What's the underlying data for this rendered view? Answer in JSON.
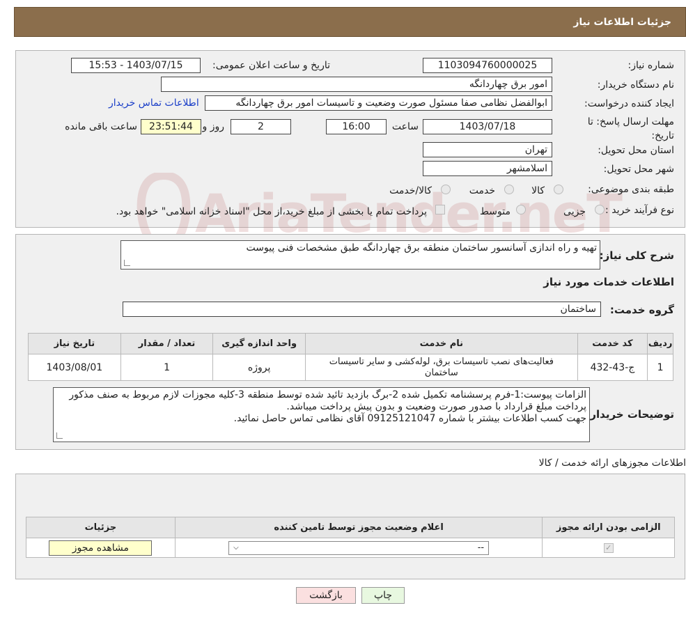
{
  "header": {
    "title": "جزئیات اطلاعات نیاز"
  },
  "watermark": {
    "text": "AriaTender.neT"
  },
  "info": {
    "need_number_label": "شماره نیاز:",
    "need_number": "1103094760000025",
    "announce_label": "تاریخ و ساعت اعلان عمومی:",
    "announce_value": "1403/07/15 - 15:53",
    "buyer_label": "نام دستگاه خریدار:",
    "buyer_value": "امور برق چهاردانگه",
    "creator_label": "ایجاد کننده درخواست:",
    "creator_value": "ابوالفضل نظامی صفا مسئول صورت وضعیت و تاسیسات امور برق چهاردانگه",
    "contact_link": "اطلاعات تماس خریدار",
    "deadline_label_1": "مهلت ارسال پاسخ: تا",
    "deadline_label_2": "تاریخ:",
    "deadline_date": "1403/07/18",
    "time_label": "ساعت",
    "deadline_time": "16:00",
    "days_value": "2",
    "days_label": "روز و",
    "remaining_value": "23:51:44",
    "remaining_label": "ساعت باقی مانده",
    "province_label": "استان محل تحویل:",
    "province_value": "تهران",
    "city_label": "شهر محل تحویل:",
    "city_value": "اسلامشهر",
    "category_label": "طبقه بندی موضوعی:",
    "category_options": [
      "کالا",
      "خدمت",
      "کالا/خدمت"
    ],
    "purchase_label": "نوع فرآیند خرید :",
    "purchase_options": [
      "جزیی",
      "متوسط"
    ],
    "purchase_note": "پرداخت تمام یا بخشی از مبلغ خرید،از محل \"اسناد خزانه اسلامی\" خواهد بود."
  },
  "description": {
    "summary_label": "شرح کلی نیاز:",
    "summary_value": "تهیه و راه اندازی آسانسور ساختمان منطقه برق چهاردانگه طبق مشخصات فنی پیوست",
    "services_title": "اطلاعات خدمات مورد نیاز",
    "service_group_label": "گروه خدمت:",
    "service_group_value": "ساختمان",
    "table_headers": [
      "ردیف",
      "کد خدمت",
      "نام خدمت",
      "واحد اندازه گیری",
      "تعداد / مقدار",
      "تاریخ نیاز"
    ],
    "rows": [
      {
        "row": "1",
        "code": "ج-43-432",
        "name": "فعالیت‌های نصب تاسیسات برق، لوله‌کشی و سایر تاسیسات ساختمان",
        "unit": "پروژه",
        "qty": "1",
        "date": "1403/08/01"
      }
    ],
    "buyer_notes_label": "توضیحات خریدار:",
    "buyer_notes": [
      "الزامات پیوست:1-فرم پرسشنامه تکمیل شده 2-برگ بازدید تائید شده توسط منطقه 3-کلیه مجوزات لازم مربوط به صنف مذکور",
      "پرداخت مبلغ قرارداد با صدور صورت وضعیت و بدون پیش پرداخت میباشد.",
      "جهت کسب اطلاعات بیشتر با شماره 09125121047 آقای نظامی تماس حاصل نمائید."
    ]
  },
  "licenses": {
    "title": "اطلاعات مجوزهای ارائه خدمت / کالا",
    "headers": [
      "الزامی بودن ارائه مجوز",
      "اعلام وضعیت مجوز توسط تامین کننده",
      "جزئیات"
    ],
    "select_value": "--",
    "view_button": "مشاهده مجوز"
  },
  "buttons": {
    "print": "چاپ",
    "back": "بازگشت"
  }
}
